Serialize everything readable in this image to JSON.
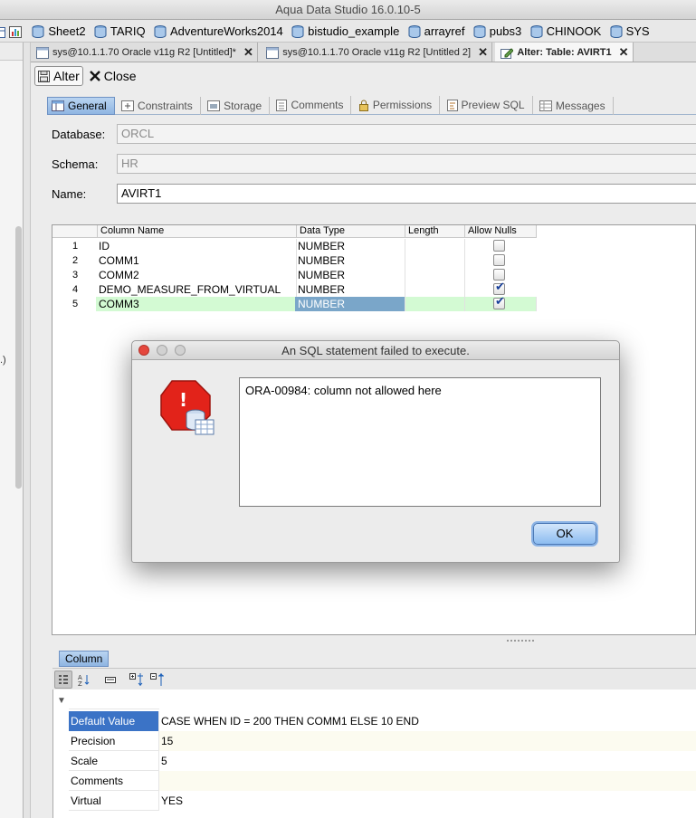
{
  "app": {
    "title": "Aqua Data Studio 16.0.10-5"
  },
  "connections": [
    "Sheet2",
    "TARIQ",
    "AdventureWorks2014",
    "bistudio_example",
    "arrayref",
    "pubs3",
    "CHINOOK",
    "SYS"
  ],
  "editor_tabs": [
    {
      "label": "sys@10.1.1.70 Oracle  v11g R2 [Untitled]*",
      "close": "✕"
    },
    {
      "label": "sys@10.1.1.70 Oracle  v11g R2 [Untitled 2]",
      "close": "✕"
    },
    {
      "label": "Alter: Table: AVIRT1",
      "close": "✕"
    }
  ],
  "toolbar": {
    "alter_label": "Alter",
    "close_label": "Close"
  },
  "sub_tabs": [
    "General",
    "Constraints",
    "Storage",
    "Comments",
    "Permissions",
    "Preview SQL",
    "Messages"
  ],
  "form": {
    "database_label": "Database:",
    "database_value": "ORCL",
    "schema_label": "Schema:",
    "schema_value": "HR",
    "name_label": "Name:",
    "name_value": "AVIRT1"
  },
  "grid": {
    "headers": [
      "Column Name",
      "Data Type",
      "Length",
      "Allow Nulls"
    ],
    "rows": [
      {
        "num": "1",
        "name": "ID",
        "type": "NUMBER",
        "length": "",
        "nulls": false
      },
      {
        "num": "2",
        "name": "COMM1",
        "type": "NUMBER",
        "length": "",
        "nulls": false
      },
      {
        "num": "3",
        "name": "COMM2",
        "type": "NUMBER",
        "length": "",
        "nulls": false
      },
      {
        "num": "4",
        "name": "DEMO_MEASURE_FROM_VIRTUAL",
        "type": "NUMBER",
        "length": "",
        "nulls": true
      },
      {
        "num": "5",
        "name": "COMM3",
        "type": "NUMBER",
        "length": "",
        "nulls": true
      }
    ],
    "selected_row": 4
  },
  "column_panel": {
    "tab_label": "Column",
    "properties": [
      {
        "name": "Default Value",
        "value": "CASE WHEN  ID = 200 THEN COMM1 ELSE 10 END"
      },
      {
        "name": "Precision",
        "value": "15"
      },
      {
        "name": "Scale",
        "value": "5"
      },
      {
        "name": "Comments",
        "value": ""
      },
      {
        "name": "Virtual",
        "value": "YES"
      }
    ]
  },
  "dialog": {
    "title": "An SQL statement failed to execute.",
    "message": "ORA-00984: column not allowed here",
    "ok_label": "OK"
  },
  "left_glyph": ".)",
  "colors": {
    "accent": "#3b73c6",
    "selected_row": "#d3fad3",
    "ok_button": "#8cbcf0"
  }
}
